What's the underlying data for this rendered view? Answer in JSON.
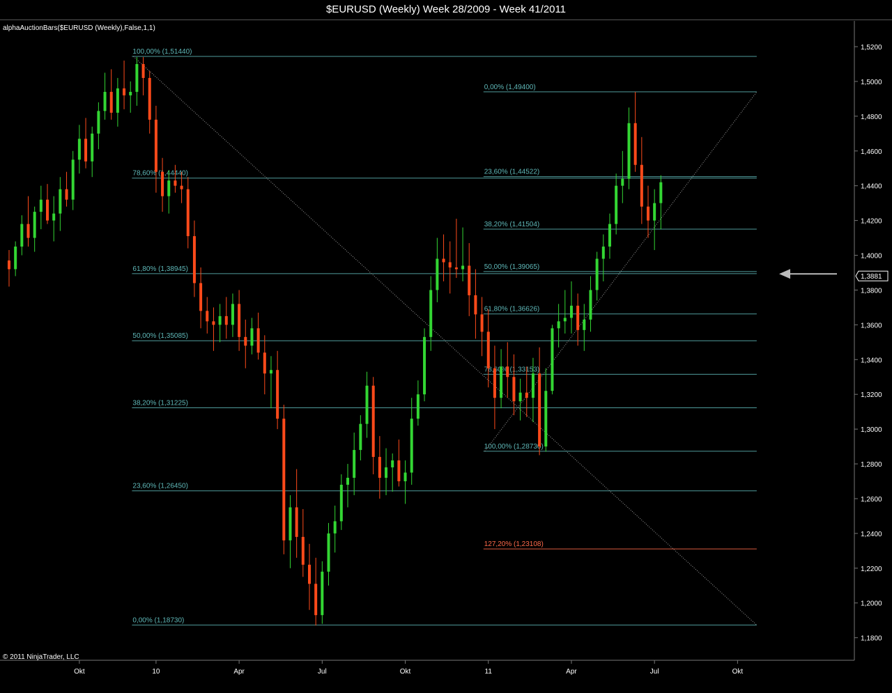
{
  "window": {
    "title": "$EURUSD (Weekly)  Week 28/2009 - Week 41/2011"
  },
  "chart_data": {
    "type": "candlestick",
    "indicator_label": "alphaAuctionBars($EURUSD (Weekly),False,1,1)",
    "copyright": "© 2011 NinjaTrader, LLC",
    "ylim": [
      1.17,
      1.527
    ],
    "y_ticks": [
      "1,5200",
      "1,5000",
      "1,4800",
      "1,4600",
      "1,4400",
      "1,4200",
      "1,4000",
      "1,3800",
      "1,3600",
      "1,3400",
      "1,3200",
      "1,3000",
      "1,2800",
      "1,2600",
      "1,2400",
      "1,2200",
      "1,2000",
      "1,1800"
    ],
    "y_tick_values": [
      1.52,
      1.5,
      1.48,
      1.46,
      1.44,
      1.42,
      1.4,
      1.38,
      1.36,
      1.34,
      1.32,
      1.3,
      1.28,
      1.26,
      1.24,
      1.22,
      1.2,
      1.18
    ],
    "x_ticks": [
      {
        "label": "Okt",
        "week": 12
      },
      {
        "label": "10",
        "week": 24
      },
      {
        "label": "Apr",
        "week": 37
      },
      {
        "label": "Jul",
        "week": 50
      },
      {
        "label": "Okt",
        "week": 63
      },
      {
        "label": "11",
        "week": 76
      },
      {
        "label": "Apr",
        "week": 89
      },
      {
        "label": "Jul",
        "week": 102
      },
      {
        "label": "Okt",
        "week": 115
      }
    ],
    "last_price": {
      "label": "1,3881",
      "value": 1.3881
    },
    "colors": {
      "up": "#33d633",
      "down": "#ff4a1a",
      "fib_lines": "#5fb8b8",
      "fib_text": "#5fb8b8",
      "extension": "#ff6a4a",
      "grid_frame": "#777777",
      "diagonal": "#aaaaaa",
      "arrow": "#bbbbbb"
    },
    "fib_retracement_1": {
      "start_week": 21,
      "end_week": 118,
      "levels": [
        {
          "label": "100,00% (1,51440)",
          "value": 1.5144
        },
        {
          "label": "78,60% (1,44440)",
          "value": 1.4444
        },
        {
          "label": "61,80% (1,38945)",
          "value": 1.38945
        },
        {
          "label": "50,00% (1,35085)",
          "value": 1.35085
        },
        {
          "label": "38,20% (1,31225)",
          "value": 1.31225
        },
        {
          "label": "23,60% (1,26450)",
          "value": 1.2645
        },
        {
          "label": "0,00% (1,18730)",
          "value": 1.1873
        }
      ],
      "diagonal": {
        "from_week": 21,
        "from_value": 1.5144,
        "to_week": 118,
        "to_value": 1.1873
      }
    },
    "fib_retracement_2": {
      "start_week": 76,
      "end_week": 118,
      "levels": [
        {
          "label": "0,00% (1,49400)",
          "value": 1.494,
          "style": "normal"
        },
        {
          "label": "23,60% (1,44522)",
          "value": 1.44522,
          "style": "normal"
        },
        {
          "label": "38,20% (1,41504)",
          "value": 1.41504,
          "style": "normal"
        },
        {
          "label": "50,00% (1,39065)",
          "value": 1.39065,
          "style": "normal"
        },
        {
          "label": "61,80% (1,36626)",
          "value": 1.36626,
          "style": "normal"
        },
        {
          "label": "78,60% (1,33153)",
          "value": 1.33153,
          "style": "normal"
        },
        {
          "label": "100,00% (1,28730)",
          "value": 1.2873,
          "style": "normal"
        },
        {
          "label": "127,20% (1,23108)",
          "value": 1.23108,
          "style": "extension"
        }
      ],
      "diagonal": {
        "from_week": 76,
        "from_value": 1.2873,
        "to_week": 118,
        "to_value": 1.494
      }
    },
    "candles": [
      [
        1.397,
        1.403,
        1.382,
        1.392
      ],
      [
        1.392,
        1.408,
        1.388,
        1.405
      ],
      [
        1.405,
        1.423,
        1.4,
        1.418
      ],
      [
        1.418,
        1.434,
        1.405,
        1.41
      ],
      [
        1.41,
        1.428,
        1.402,
        1.425
      ],
      [
        1.425,
        1.44,
        1.415,
        1.432
      ],
      [
        1.432,
        1.441,
        1.418,
        1.42
      ],
      [
        1.42,
        1.434,
        1.408,
        1.424
      ],
      [
        1.424,
        1.445,
        1.414,
        1.438
      ],
      [
        1.438,
        1.448,
        1.428,
        1.432
      ],
      [
        1.432,
        1.46,
        1.426,
        1.455
      ],
      [
        1.455,
        1.475,
        1.447,
        1.467
      ],
      [
        1.467,
        1.479,
        1.45,
        1.454
      ],
      [
        1.454,
        1.474,
        1.445,
        1.47
      ],
      [
        1.47,
        1.488,
        1.461,
        1.483
      ],
      [
        1.483,
        1.505,
        1.478,
        1.494
      ],
      [
        1.494,
        1.507,
        1.478,
        1.482
      ],
      [
        1.482,
        1.502,
        1.474,
        1.496
      ],
      [
        1.496,
        1.512,
        1.484,
        1.492
      ],
      [
        1.492,
        1.5,
        1.482,
        1.494
      ],
      [
        1.494,
        1.514,
        1.486,
        1.51
      ],
      [
        1.51,
        1.514,
        1.492,
        1.502
      ],
      [
        1.502,
        1.506,
        1.47,
        1.478
      ],
      [
        1.478,
        1.486,
        1.436,
        1.448
      ],
      [
        1.448,
        1.456,
        1.425,
        1.434
      ],
      [
        1.434,
        1.449,
        1.424,
        1.443
      ],
      [
        1.443,
        1.452,
        1.436,
        1.44
      ],
      [
        1.44,
        1.448,
        1.43,
        1.438
      ],
      [
        1.438,
        1.445,
        1.404,
        1.411
      ],
      [
        1.411,
        1.42,
        1.376,
        1.384
      ],
      [
        1.384,
        1.393,
        1.358,
        1.368
      ],
      [
        1.368,
        1.376,
        1.355,
        1.362
      ],
      [
        1.362,
        1.37,
        1.345,
        1.36
      ],
      [
        1.36,
        1.372,
        1.35,
        1.365
      ],
      [
        1.365,
        1.376,
        1.352,
        1.36
      ],
      [
        1.36,
        1.378,
        1.353,
        1.372
      ],
      [
        1.372,
        1.38,
        1.345,
        1.353
      ],
      [
        1.353,
        1.363,
        1.335,
        1.348
      ],
      [
        1.348,
        1.364,
        1.343,
        1.358
      ],
      [
        1.358,
        1.367,
        1.34,
        1.344
      ],
      [
        1.344,
        1.354,
        1.32,
        1.332
      ],
      [
        1.332,
        1.342,
        1.312,
        1.334
      ],
      [
        1.334,
        1.345,
        1.3,
        1.306
      ],
      [
        1.306,
        1.314,
        1.228,
        1.236
      ],
      [
        1.236,
        1.262,
        1.22,
        1.255
      ],
      [
        1.255,
        1.277,
        1.226,
        1.238
      ],
      [
        1.238,
        1.254,
        1.215,
        1.222
      ],
      [
        1.222,
        1.234,
        1.196,
        1.211
      ],
      [
        1.211,
        1.226,
        1.187,
        1.193
      ],
      [
        1.193,
        1.224,
        1.188,
        1.218
      ],
      [
        1.218,
        1.246,
        1.21,
        1.24
      ],
      [
        1.24,
        1.256,
        1.229,
        1.247
      ],
      [
        1.247,
        1.274,
        1.242,
        1.268
      ],
      [
        1.268,
        1.28,
        1.255,
        1.272
      ],
      [
        1.272,
        1.298,
        1.262,
        1.288
      ],
      [
        1.288,
        1.308,
        1.282,
        1.303
      ],
      [
        1.303,
        1.333,
        1.295,
        1.325
      ],
      [
        1.325,
        1.33,
        1.274,
        1.284
      ],
      [
        1.284,
        1.296,
        1.26,
        1.272
      ],
      [
        1.272,
        1.289,
        1.262,
        1.278
      ],
      [
        1.278,
        1.286,
        1.264,
        1.282
      ],
      [
        1.282,
        1.294,
        1.267,
        1.27
      ],
      [
        1.27,
        1.282,
        1.257,
        1.275
      ],
      [
        1.275,
        1.318,
        1.268,
        1.306
      ],
      [
        1.306,
        1.328,
        1.302,
        1.32
      ],
      [
        1.32,
        1.358,
        1.316,
        1.353
      ],
      [
        1.353,
        1.388,
        1.345,
        1.38
      ],
      [
        1.38,
        1.41,
        1.373,
        1.398
      ],
      [
        1.398,
        1.412,
        1.385,
        1.396
      ],
      [
        1.396,
        1.408,
        1.378,
        1.393
      ],
      [
        1.393,
        1.421,
        1.387,
        1.392
      ],
      [
        1.392,
        1.416,
        1.385,
        1.394
      ],
      [
        1.394,
        1.407,
        1.365,
        1.377
      ],
      [
        1.377,
        1.392,
        1.352,
        1.366
      ],
      [
        1.366,
        1.376,
        1.342,
        1.356
      ],
      [
        1.356,
        1.369,
        1.324,
        1.335
      ],
      [
        1.335,
        1.348,
        1.3,
        1.318
      ],
      [
        1.318,
        1.346,
        1.312,
        1.336
      ],
      [
        1.336,
        1.35,
        1.318,
        1.33
      ],
      [
        1.33,
        1.343,
        1.308,
        1.316
      ],
      [
        1.316,
        1.329,
        1.305,
        1.321
      ],
      [
        1.321,
        1.336,
        1.307,
        1.318
      ],
      [
        1.318,
        1.341,
        1.304,
        1.332
      ],
      [
        1.332,
        1.347,
        1.285,
        1.29
      ],
      [
        1.29,
        1.335,
        1.287,
        1.322
      ],
      [
        1.322,
        1.36,
        1.32,
        1.358
      ],
      [
        1.358,
        1.372,
        1.347,
        1.362
      ],
      [
        1.362,
        1.38,
        1.355,
        1.364
      ],
      [
        1.364,
        1.385,
        1.355,
        1.371
      ],
      [
        1.371,
        1.378,
        1.348,
        1.357
      ],
      [
        1.357,
        1.372,
        1.345,
        1.363
      ],
      [
        1.363,
        1.388,
        1.356,
        1.38
      ],
      [
        1.38,
        1.402,
        1.374,
        1.398
      ],
      [
        1.398,
        1.412,
        1.385,
        1.405
      ],
      [
        1.405,
        1.424,
        1.398,
        1.418
      ],
      [
        1.418,
        1.447,
        1.412,
        1.44
      ],
      [
        1.44,
        1.46,
        1.43,
        1.444
      ],
      [
        1.444,
        1.485,
        1.438,
        1.476
      ],
      [
        1.476,
        1.494,
        1.448,
        1.452
      ],
      [
        1.452,
        1.468,
        1.418,
        1.428
      ],
      [
        1.428,
        1.44,
        1.41,
        1.42
      ],
      [
        1.42,
        1.438,
        1.403,
        1.43
      ],
      [
        1.43,
        1.446,
        1.415,
        1.442
      ]
    ]
  }
}
